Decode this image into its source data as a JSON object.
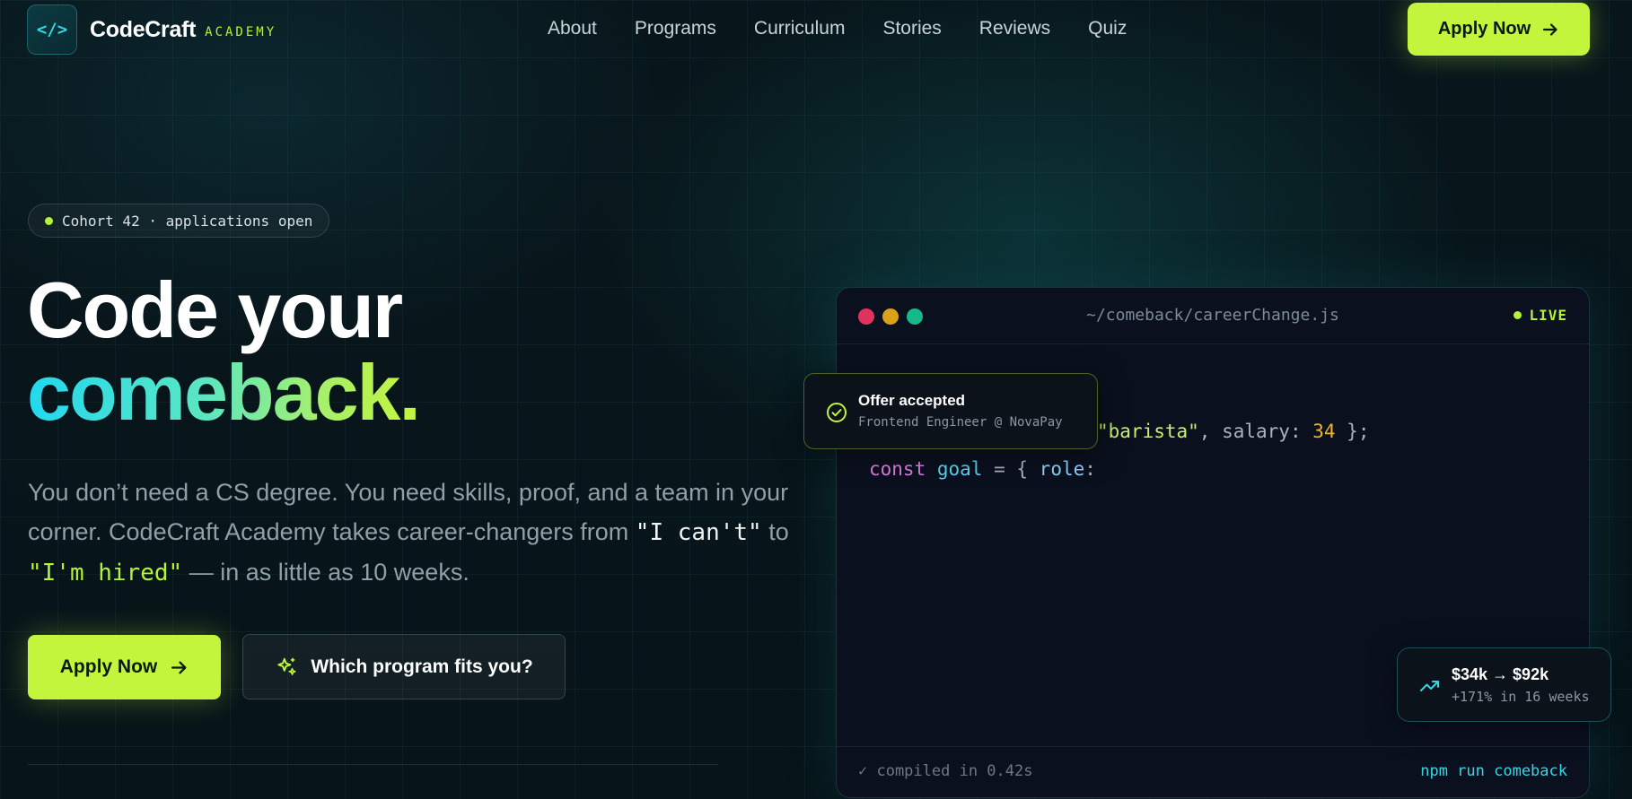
{
  "brand": {
    "logo_glyph": "</>",
    "name": "CodeCraft",
    "sub": "ACADEMY",
    "accent": "#c2f53b",
    "cyan": "#35d6e6"
  },
  "nav": {
    "links": [
      "About",
      "Programs",
      "Curriculum",
      "Stories",
      "Reviews",
      "Quiz"
    ],
    "cta": "Apply Now"
  },
  "hero": {
    "badge": "Cohort 42 · applications open",
    "title_line1": "Code your",
    "title_line2": "comeback.",
    "desc_part1": "You don’t need a CS degree. You need skills, proof, and a team in your corner. CodeCraft Academy takes career-changers from ",
    "desc_quote1": "\"I can't\"",
    "desc_to": " to ",
    "desc_quote2": "\"I'm hired\"",
    "desc_part2": " — in as little as 10 weeks.",
    "cta_primary": "Apply Now",
    "cta_secondary": "Which program fits you?"
  },
  "code_window": {
    "filename": "~/comeback/careerChange.js",
    "status": "LIVE",
    "line1": {
      "str": "\"barista\"",
      "mid": ", salary: ",
      "num": "34",
      "end": " };"
    },
    "line2": {
      "kw": "const",
      "var": "goal",
      "op": " = { ",
      "prop": "role",
      "colon": ":"
    },
    "footer_left": "✓ compiled in 0.42s",
    "footer_right": "npm run comeback"
  },
  "offer_card": {
    "title": "Offer accepted",
    "subtitle": "Frontend Engineer @ NovaPay"
  },
  "salary_card": {
    "title": "$34k → $92k",
    "subtitle": "+171% in 16 weeks"
  }
}
